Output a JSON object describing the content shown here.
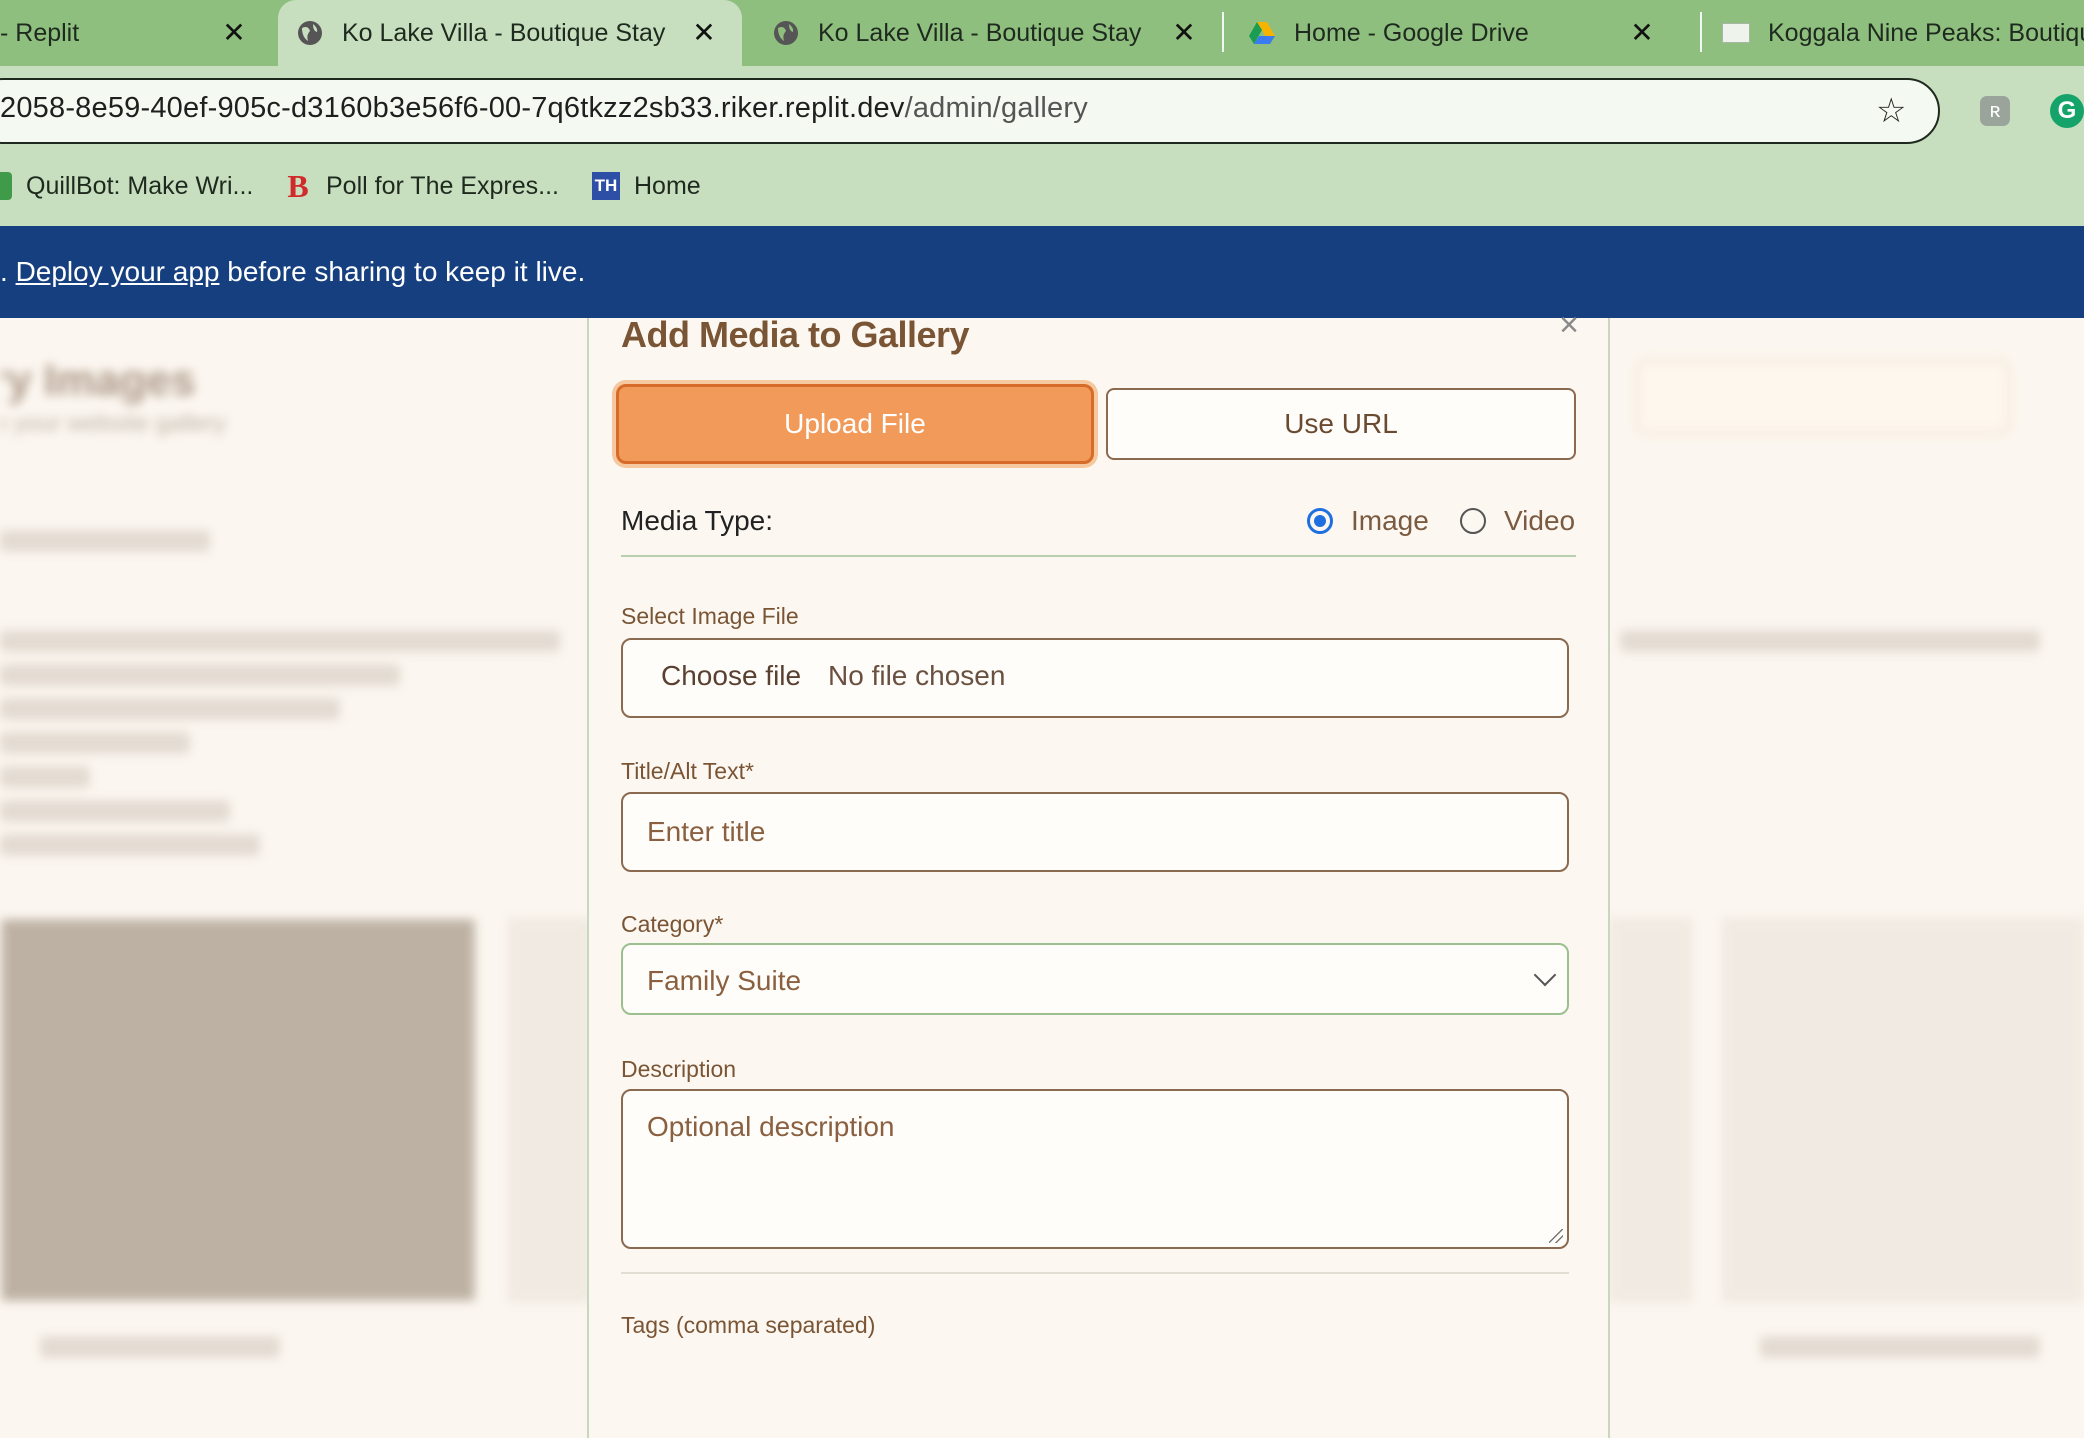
{
  "browser": {
    "tabs": [
      {
        "title": "- Replit",
        "active": false,
        "close": "✕"
      },
      {
        "title": "Ko Lake Villa - Boutique Stay",
        "active": true,
        "close": "✕"
      },
      {
        "title": "Ko Lake Villa - Boutique Stay",
        "active": false,
        "close": "✕"
      },
      {
        "title": "Home - Google Drive",
        "active": false,
        "close": "✕"
      },
      {
        "title": "Koggala Nine Peaks: Boutiqu",
        "active": false
      }
    ],
    "url_host": "2058-8e59-40ef-905c-d3160b3e56f6-00-7q6tkzz2sb33.riker.replit.dev",
    "url_path": "/admin/gallery",
    "bookmarks": [
      {
        "label": "QuillBot: Make Wri...",
        "icon": "quillbot-icon"
      },
      {
        "label": "Poll for The Expres...",
        "icon": "b-logo-icon",
        "icon_text": "B"
      },
      {
        "label": "Home",
        "icon": "th-logo-icon",
        "icon_text": "TH"
      }
    ],
    "extension_letter": "G"
  },
  "banner": {
    "prefix": ".",
    "link": "Deploy your app",
    "suffix": " before sharing to keep it live."
  },
  "background": {
    "heading": "ry Images",
    "subheading": "e your website gallery"
  },
  "modal": {
    "title": "Add Media to Gallery",
    "close": "×",
    "upload_label": "Upload File",
    "url_label": "Use URL",
    "media_type_label": "Media Type:",
    "media_options": [
      {
        "label": "Image",
        "selected": true
      },
      {
        "label": "Video",
        "selected": false
      }
    ],
    "file": {
      "label": "Select Image File",
      "button": "Choose file",
      "status": "No file chosen"
    },
    "title_field": {
      "label": "Title/Alt Text*",
      "placeholder": "Enter title"
    },
    "category": {
      "label": "Category*",
      "value": "Family Suite"
    },
    "description": {
      "label": "Description",
      "placeholder": "Optional description"
    },
    "tags_label": "Tags (comma separated)"
  },
  "colors": {
    "primary": "#f19a5a",
    "banner": "#163f80",
    "tabbar": "#8fbf7f",
    "heading": "#7a5535"
  }
}
